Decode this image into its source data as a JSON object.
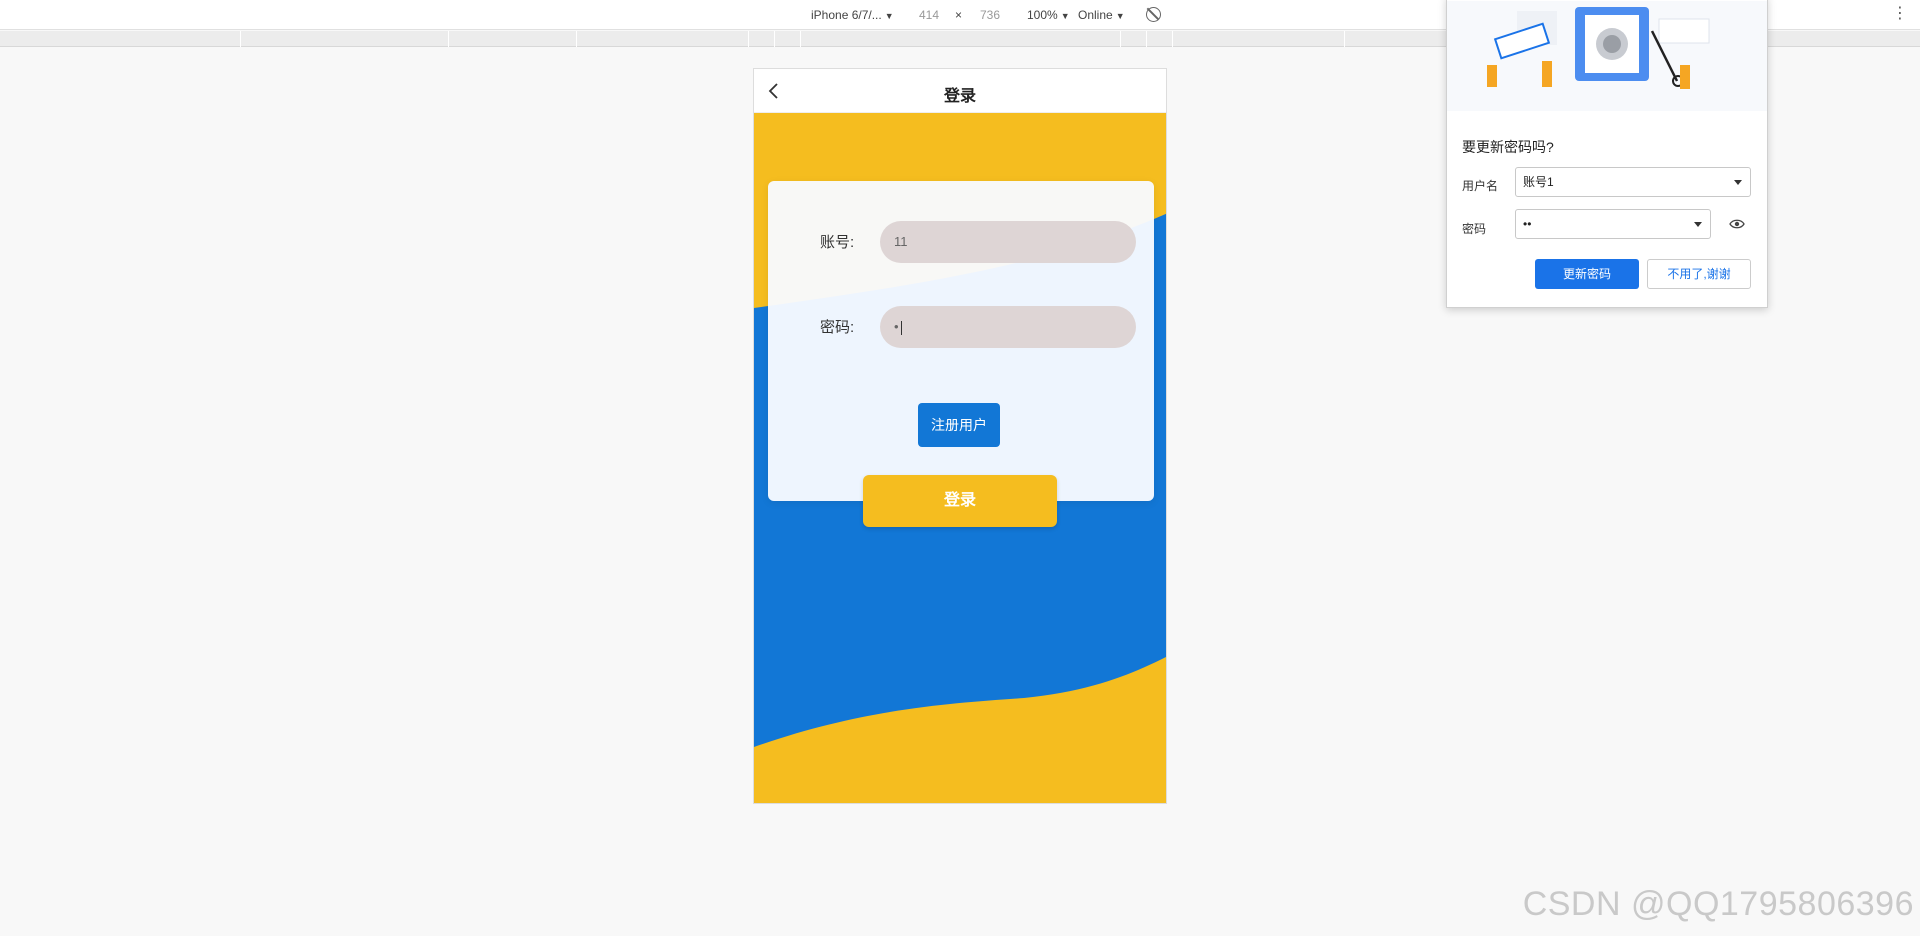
{
  "devtools": {
    "device": "iPhone 6/7/...",
    "width": "414",
    "times": "×",
    "height": "736",
    "zoom": "100%",
    "network": "Online"
  },
  "app": {
    "title": "登录",
    "account_label": "账号:",
    "account_value": "11",
    "password_label": "密码:",
    "password_value": "•",
    "register_label": "注册用户",
    "login_label": "登录",
    "colors": {
      "blue": "#1277d6",
      "yellow": "#f5bd1f"
    }
  },
  "popup": {
    "title": "要更新密码吗?",
    "username_label": "用户名",
    "username_value": "账号1",
    "password_label": "密码",
    "password_value": "••",
    "update_label": "更新密码",
    "dismiss_label": "不用了,谢谢",
    "accent": "#1a73e8"
  },
  "watermark": "CSDN @QQ1795806396"
}
